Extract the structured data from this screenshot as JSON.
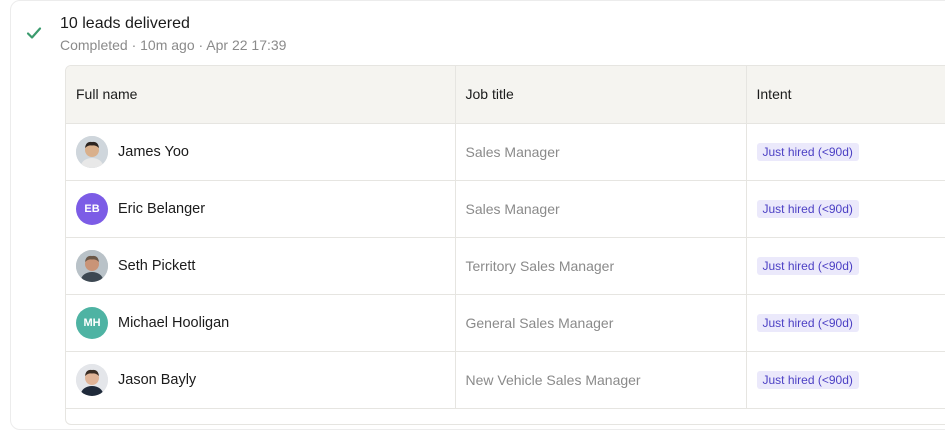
{
  "summary": {
    "title": "10 leads delivered",
    "subtitle": "Completed · 10m ago · Apr 22 17:39",
    "status_color": "#3b9b6e"
  },
  "table": {
    "headers": {
      "full_name": "Full name",
      "job_title": "Job title",
      "intent": "Intent"
    },
    "rows": [
      {
        "name": "James Yoo",
        "job_title": "Sales Manager",
        "intent": "Just hired (<90d)",
        "avatar": {
          "type": "photo",
          "icon": "person-photo-icon",
          "bg": "#cfd6dc",
          "skin": "#d9b08c",
          "hair": "#2b2420",
          "shirt": "#e8e8e8"
        }
      },
      {
        "name": "Eric Belanger",
        "job_title": "Sales Manager",
        "intent": "Just hired (<90d)",
        "avatar": {
          "type": "initials",
          "initials": "EB",
          "bg": "#7c5ce6"
        }
      },
      {
        "name": "Seth Pickett",
        "job_title": "Territory Sales Manager",
        "intent": "Just hired (<90d)",
        "avatar": {
          "type": "photo",
          "icon": "person-photo-icon",
          "bg": "#b9c2c8",
          "skin": "#c99477",
          "hair": "#6b5848",
          "shirt": "#3d4852"
        }
      },
      {
        "name": "Michael Hooligan",
        "job_title": "General Sales Manager",
        "intent": "Just hired (<90d)",
        "avatar": {
          "type": "initials",
          "initials": "MH",
          "bg": "#4eb3a3"
        }
      },
      {
        "name": "Jason Bayly",
        "job_title": "New Vehicle Sales Manager",
        "intent": "Just hired (<90d)",
        "avatar": {
          "type": "photo",
          "icon": "person-photo-icon",
          "bg": "#e4e6ea",
          "skin": "#e0b497",
          "hair": "#3a2d24",
          "shirt": "#1f2a3a"
        }
      }
    ]
  }
}
